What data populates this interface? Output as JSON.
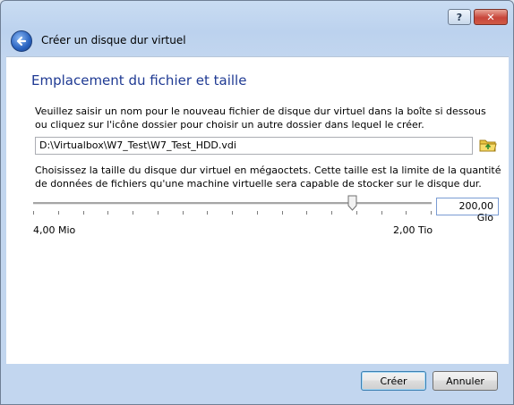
{
  "window": {
    "help_glyph": "?",
    "close_glyph": "✕",
    "title": "Créer un disque dur virtuel"
  },
  "page": {
    "heading": "Emplacement du fichier et taille",
    "file_instructions": "Veuillez saisir un nom pour le nouveau fichier de disque dur virtuel dans la boîte si dessous ou cliquez sur l'icône dossier pour choisir un autre dossier dans lequel le créer.",
    "file_path": "D:\\Virtualbox\\W7_Test\\W7_Test_HDD.vdi",
    "size_instructions": "Choisissez la taille du disque dur virtuel en mégaoctets. Cette taille est la limite de la quantité de données de fichiers qu'une machine virtuelle sera capable de stocker sur le disque dur.",
    "size_value": "200,00 Gio",
    "slider_level": 0.8,
    "min_label": "4,00 Mio",
    "max_label": "2,00 Tio"
  },
  "buttons": {
    "create": "Créer",
    "cancel": "Annuler"
  },
  "icons": {
    "back": "back-arrow-icon",
    "folder": "folder-icon"
  },
  "colors": {
    "heading": "#1f3a93",
    "title_bar": "#bcd2ee",
    "close": "#c8463b"
  }
}
